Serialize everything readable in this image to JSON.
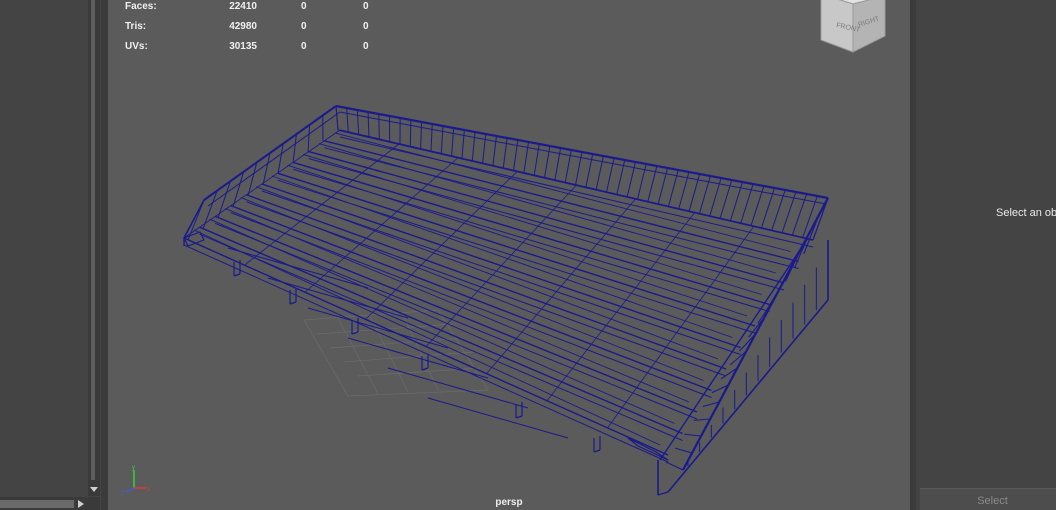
{
  "hud": {
    "rows": [
      {
        "label": "Faces:",
        "v1": "22410",
        "v2": "0",
        "v3": "0"
      },
      {
        "label": "Tris:",
        "v1": "42980",
        "v2": "0",
        "v3": "0"
      },
      {
        "label": "UVs:",
        "v1": "30135",
        "v2": "0",
        "v3": "0"
      }
    ]
  },
  "viewport": {
    "camera": "persp",
    "wireframe_color": "#1a1a8c",
    "background_color": "#5b5b5b"
  },
  "view_cube": {
    "front_label": "FRONT",
    "right_label": "RIGHT"
  },
  "attribute_panel": {
    "message": "Select an ob",
    "select_label": "Select"
  }
}
